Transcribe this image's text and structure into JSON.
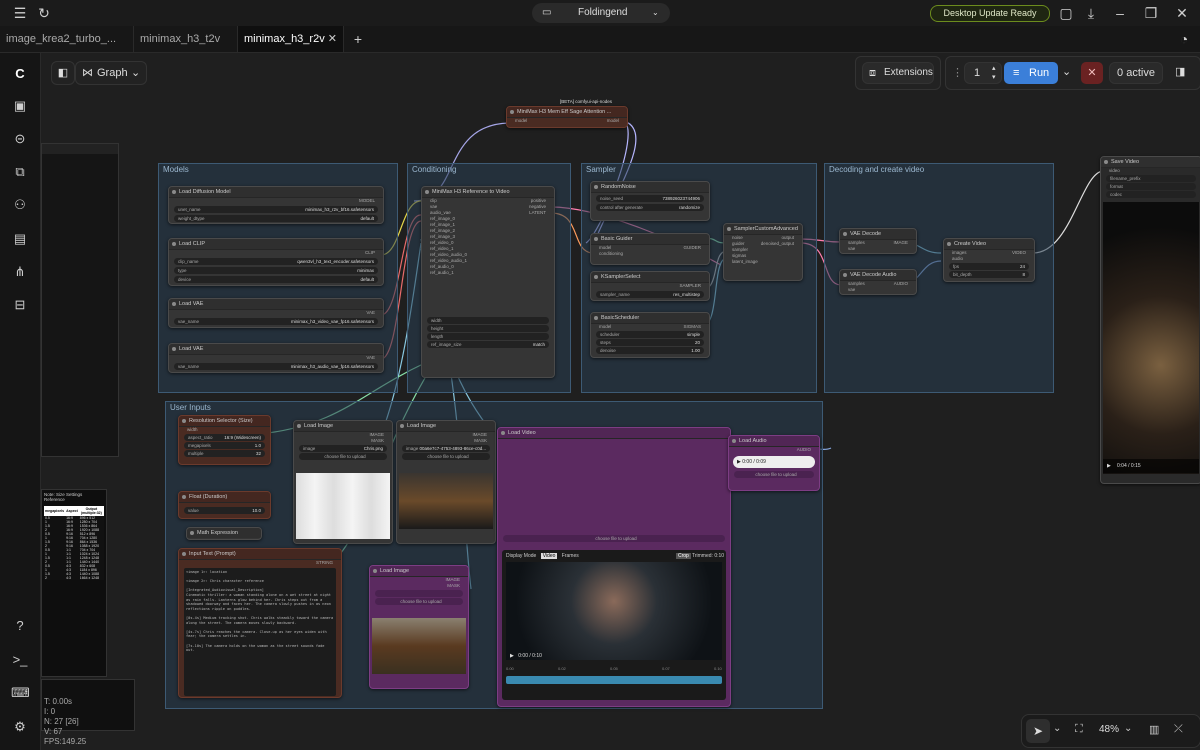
{
  "titlebar": {
    "workspace": "Foldingend",
    "update_badge": "Desktop Update Ready"
  },
  "tabs": [
    {
      "label": "image_krea2_turbo_..."
    },
    {
      "label": "minimax_h3_t2v"
    },
    {
      "label": "minimax_h3_r2v"
    }
  ],
  "toolbar": {
    "view_mode": "Graph",
    "extensions_label": "Extensions",
    "batch_count": "1",
    "run_label": "Run",
    "active_label": "0 active",
    "zoom_level": "48%"
  },
  "stats": {
    "t": "T: 0.00s",
    "i": "I: 0",
    "n": "N: 27 [26]",
    "v": "V: 67",
    "fps": "FPS:149.25"
  },
  "top_node": {
    "badge": "[BETA] comfyui-api-nodes",
    "title": "MiniMax H3 Mem Eff Sage Attention ...",
    "output": "model"
  },
  "groups": {
    "models": "Models",
    "conditioning": "Conditioning",
    "sampler": "Sampler",
    "decode": "Decoding and create video",
    "inputs": "User Inputs"
  },
  "models_nodes": [
    {
      "title": "Load Diffusion Model",
      "out": "MODEL",
      "w1": "unet_name",
      "v1": "minimax_h3_r2v_bf16.safetensors",
      "w2": "weight_dtype",
      "v2": "default"
    },
    {
      "title": "Load CLIP",
      "out": "CLIP",
      "w1": "clip_name",
      "v1": "qwen3vl_h3_text_encoder.safetensors",
      "w2": "type",
      "v2": "minimax",
      "w3": "device",
      "v3": "default"
    },
    {
      "title": "Load VAE",
      "out": "VAE",
      "w1": "vae_name",
      "v1": "minimax_h3_video_vae_fp16.safetensors"
    },
    {
      "title": "Load VAE",
      "out": "VAE",
      "w1": "vae_name",
      "v1": "minimax_h3_audio_vae_fp16.safetensors"
    }
  ],
  "ref_node": {
    "title": "MiniMax H3 Reference to Video",
    "inputs": [
      "clip",
      "vae",
      "audio_vae",
      "ref_image_0",
      "ref_image_1",
      "ref_image_2",
      "ref_image_3",
      "ref_video_0",
      "ref_video_1",
      "ref_video_audio_0",
      "ref_video_audio_1",
      "ref_audio_0",
      "ref_audio_1"
    ],
    "outputs": [
      "positive",
      "negative",
      "LATENT"
    ],
    "widgets": [
      "width",
      "height",
      "length",
      "ref_image_size"
    ],
    "ref_image_size": "match"
  },
  "sampler_nodes": {
    "noise": {
      "title": "RandomNoise",
      "w1": "noise_seed",
      "v1": "738926023744906",
      "w2": "control after generate",
      "v2": "randomize"
    },
    "guider": {
      "title": "Basic Guider",
      "in1": "model",
      "in2": "conditioning",
      "out": "GUIDER"
    },
    "ksel": {
      "title": "KSamplerSelect",
      "w1": "sampler_name",
      "v1": "res_multistep",
      "out": "SAMPLER"
    },
    "sched": {
      "title": "BasicScheduler",
      "w1": "scheduler",
      "v1": "simple",
      "w2": "steps",
      "v2": "20",
      "w3": "denoise",
      "v3": "1.00",
      "out": "SIGMAS"
    },
    "custom": {
      "title": "SamplerCustomAdvanced",
      "inputs": [
        "noise",
        "guider",
        "sampler",
        "sigmas",
        "latent_image"
      ],
      "outputs": [
        "output",
        "denoised_output"
      ]
    }
  },
  "decode_nodes": {
    "vae_decode": {
      "title": "VAE Decode",
      "out": "IMAGE"
    },
    "audio_decode": {
      "title": "VAE Decode Audio",
      "out": "AUDIO"
    },
    "create_video": {
      "title": "Create Video",
      "out": "VIDEO",
      "w1": "fps",
      "v1": "24",
      "w2": "bit_depth",
      "v2": "8"
    },
    "save_video": {
      "title": "Save Video",
      "w1": "filename_prefix",
      "w2": "format",
      "w3": "codec"
    }
  },
  "input_nodes": {
    "res": {
      "title": "Resolution Selector (Size)",
      "w1": "aspect_ratio",
      "v1": "16:9 (Widescreen)",
      "w2": "megapixels",
      "v2": "1.0",
      "w3": "multiple",
      "v3": "32"
    },
    "fps": {
      "title": "Float (Duration)",
      "w1": "value",
      "v1": "10.0"
    },
    "math": {
      "title": "Math Expression"
    },
    "load1": {
      "title": "Load Image",
      "image": "Chris.png",
      "upload": "choose file to upload"
    },
    "load2": {
      "title": "Load Image",
      "image": "00a6e7c7-4753-4893-86ce-c0d...",
      "upload": "choose file to upload"
    },
    "load3": {
      "title": "Load Image",
      "upload": "choose file to upload"
    },
    "load_video": {
      "title": "Load Video",
      "upload": "choose file to upload",
      "duration": "0:10"
    },
    "load_audio": {
      "title": "Load Audio",
      "time": "0:00 / 0:09",
      "upload": "choose file to upload"
    },
    "prompt": {
      "title": "Input Text (Prompt)",
      "out": "STRING",
      "text": "<image 1>: location\n\n<image 2>: Chris character reference\n\n[Integrated_Audiovisual_Description]\nCinematic thriller: a woman standing alone on a wet street at night as rain falls. Lanterns glow behind her. Chris steps out from a shadowed doorway and faces her. The camera slowly pushes in as neon reflections ripple on puddles.\n\n[0s-4s] Medium tracking shot. Chris walks steadily toward the camera along the street. The camera moves slowly backward.\n\n[4s-7s] Chris reaches the camera. Close-up as her eyes widen with fear; the camera settles in.\n\n[7s-10s] The camera holds on the woman as the street sounds fade out."
    }
  },
  "preview": {
    "display_mode": "Display Mode",
    "opt1": "Video",
    "opt2": "Frames",
    "crop": "Crop",
    "trimmed": "Trimmed: 0:10",
    "time": "0:00 / 0:10",
    "ticks": [
      "0.00",
      "0.02",
      "0.05",
      "0.07",
      "0.10"
    ]
  },
  "right_video": {
    "time": "0:04 / 0:15"
  },
  "note_right": {
    "title": "Note: Size Settings Reference",
    "headers": [
      "megapixels",
      "Aspect",
      "Output (multiple:32)"
    ],
    "rows": [
      [
        "0.5",
        "16:9",
        "896 x 512"
      ],
      [
        "1",
        "16:9",
        "1280 x 704"
      ],
      [
        "1.5",
        "16:9",
        "1536 x 864"
      ],
      [
        "2",
        "16:9",
        "1920 x 1088"
      ],
      [
        "0.5",
        "9:16",
        "512 x 896"
      ],
      [
        "1",
        "9:16",
        "704 x 1280"
      ],
      [
        "1.5",
        "9:16",
        "864 x 1536"
      ],
      [
        "2",
        "9:16",
        "1088 x 1920"
      ],
      [
        "0.5",
        "1:1",
        "704 x 704"
      ],
      [
        "1",
        "1:1",
        "1024 x 1024"
      ],
      [
        "1.5",
        "1:1",
        "1248 x 1248"
      ],
      [
        "2",
        "1:1",
        "1440 x 1440"
      ],
      [
        "0.5",
        "4:3",
        "832 x 608"
      ],
      [
        "1",
        "4:3",
        "1184 x 896"
      ],
      [
        "1.5",
        "4:3",
        "1440 x 1088"
      ],
      [
        "2",
        "4:3",
        "1664 x 1248"
      ]
    ]
  }
}
